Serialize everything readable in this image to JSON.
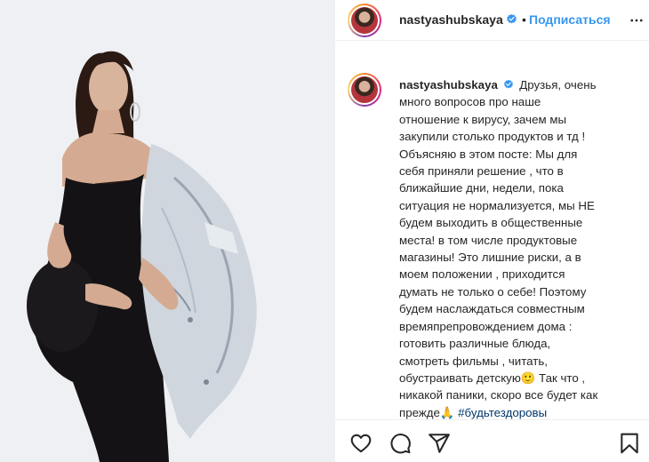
{
  "post": {
    "author": {
      "username": "nastyashubskaya",
      "verified": true,
      "verified_icon": "verified-badge-icon",
      "verified_color": "#3897f0"
    },
    "header": {
      "separator": "•",
      "follow_label": "Подписаться",
      "follow_color": "#3897f0",
      "more_icon": "more-horizontal-icon"
    },
    "caption": {
      "username": "nastyashubskaya",
      "text_lines": [
        "Друзья, очень",
        "много вопросов про наше",
        "отношение к вирусу, зачем мы",
        "закупили столько продуктов и тд !",
        "Объясняю в этом посте: Мы для",
        "себя приняли решение , что в",
        "ближайшие дни, недели, пока",
        "ситуация не нормализуется, мы НЕ",
        "будем выходить в общественные",
        "места! в том числе продуктовые",
        "магазины! Это лишние риски, а в",
        "моем положении , приходится",
        "думать не только о себе! Поэтому",
        "будем наслаждаться совместным",
        "времяпрепровождением дома :",
        "готовить различные блюда,",
        "смотреть фильмы , читать,",
        "обустраивать детскую",
        "🙂 Так что ,",
        "никакой паники, скоро все будет как",
        "прежде",
        "🙏",
        "#будьтездоровы"
      ],
      "hashtag_color": "#00376b"
    },
    "actions": {
      "like_icon": "heart-icon",
      "comment_icon": "comment-icon",
      "share_icon": "share-icon",
      "save_icon": "bookmark-icon"
    },
    "photo": {
      "description_icon": "post-photo"
    }
  }
}
